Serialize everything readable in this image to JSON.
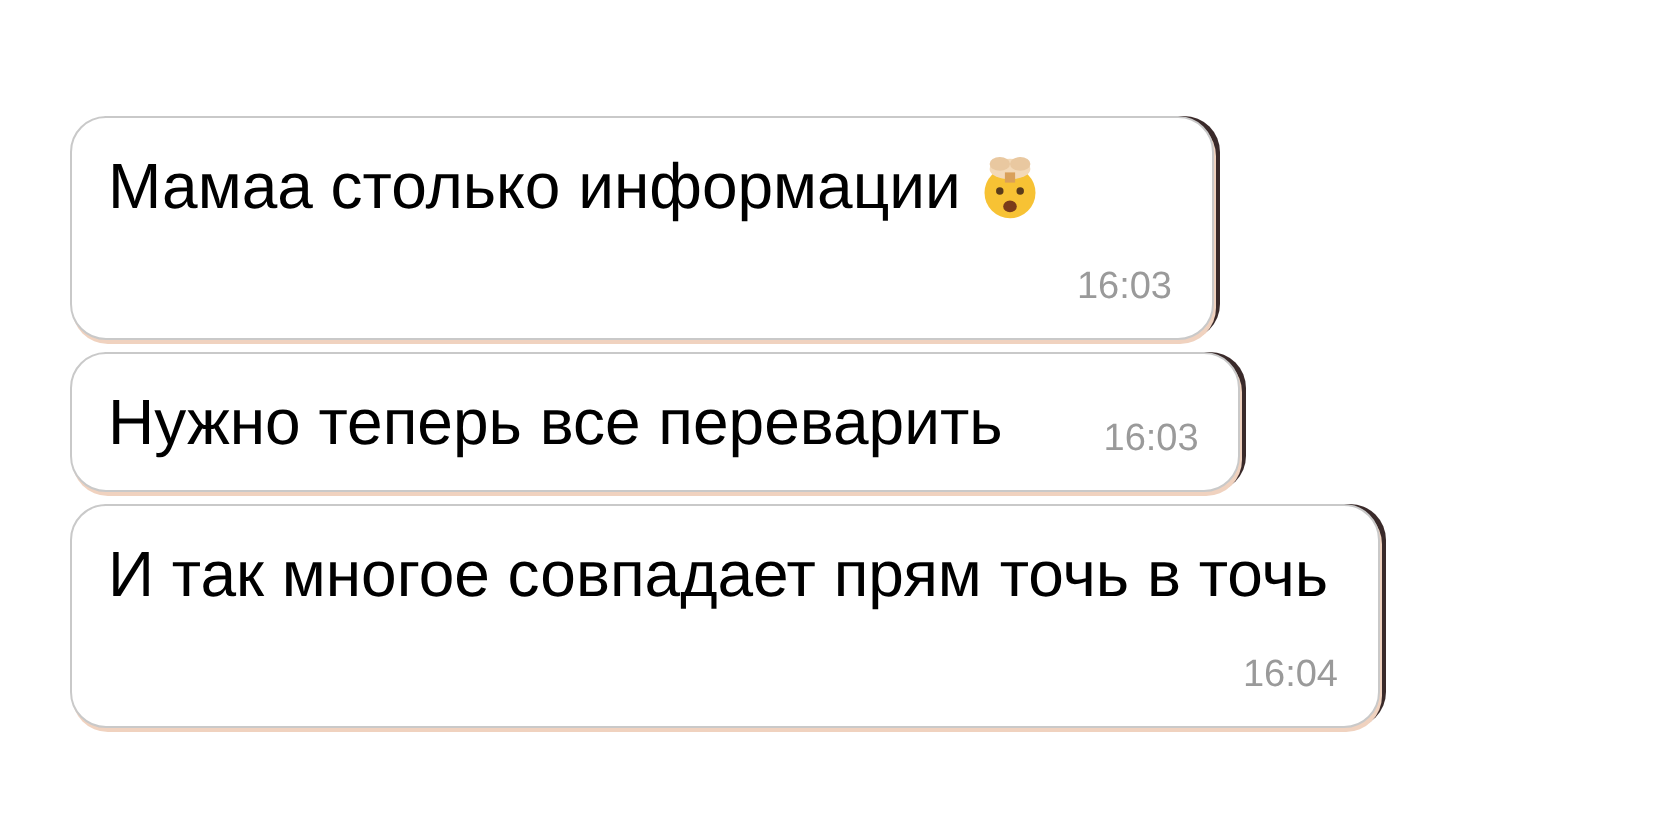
{
  "messages": [
    {
      "text": "Мамаа столько информации",
      "emoji": true,
      "time": "16:03"
    },
    {
      "text": "Нужно теперь все переварить",
      "emoji": false,
      "time": "16:03"
    },
    {
      "text": "И так многое совпадает прям точь в точь",
      "emoji": false,
      "time": "16:04"
    }
  ]
}
